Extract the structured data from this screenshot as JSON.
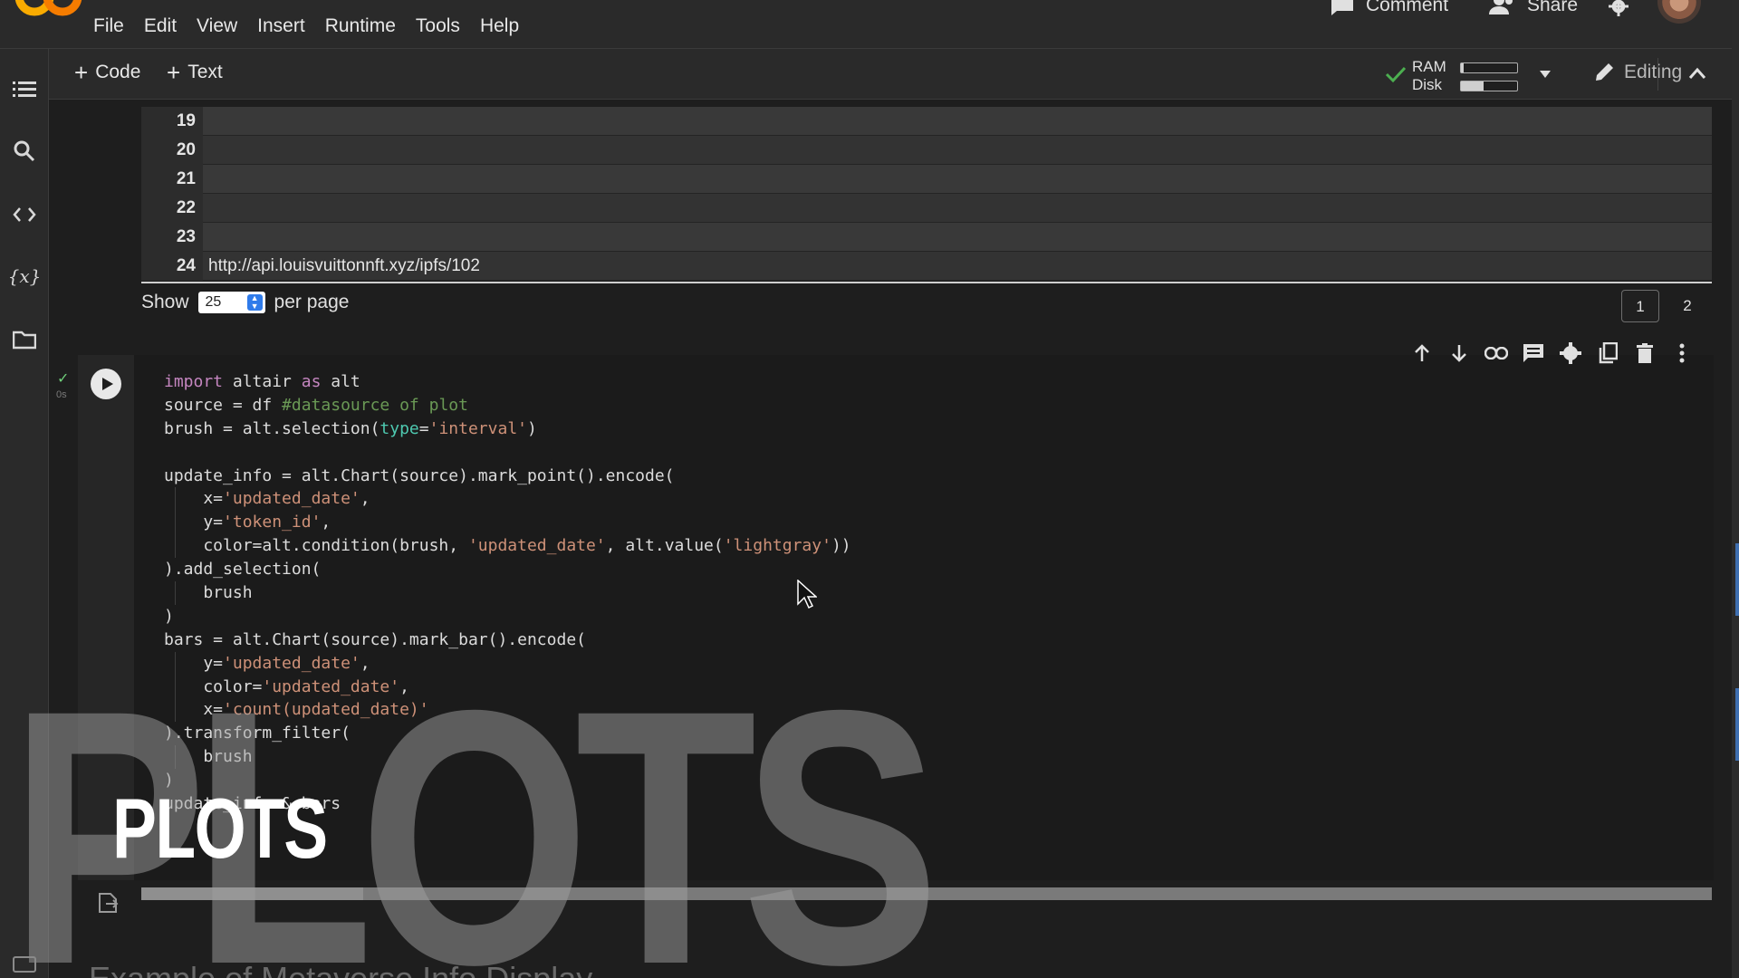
{
  "menu": [
    "File",
    "Edit",
    "View",
    "Insert",
    "Runtime",
    "Tools",
    "Help"
  ],
  "top_right": {
    "comment": "Comment",
    "share": "Share"
  },
  "toolbar": {
    "add_code": "Code",
    "add_text": "Text",
    "ram_label": "RAM",
    "disk_label": "Disk",
    "ram_usage": 0.05,
    "disk_usage": 0.4,
    "editing": "Editing"
  },
  "table": {
    "rows": [
      {
        "index": "19",
        "value": ""
      },
      {
        "index": "20",
        "value": ""
      },
      {
        "index": "21",
        "value": ""
      },
      {
        "index": "22",
        "value": ""
      },
      {
        "index": "23",
        "value": ""
      },
      {
        "index": "24",
        "value": "http://api.louisvuittonnft.xyz/ipfs/102"
      }
    ],
    "show_label": "Show",
    "per_page_value": "25",
    "per_page_label": "per page",
    "pages": [
      "1",
      "2"
    ],
    "current_page": "1"
  },
  "cell": {
    "status_time": "0s",
    "code_lines": [
      [
        {
          "t": "import",
          "c": "kw"
        },
        {
          "t": " altair "
        },
        {
          "t": "as",
          "c": "kw"
        },
        {
          "t": " alt"
        }
      ],
      [
        {
          "t": "source = df "
        },
        {
          "t": "#datasource of plot",
          "c": "cm"
        }
      ],
      [
        {
          "t": "brush = alt.selection("
        },
        {
          "t": "type",
          "c": "pm"
        },
        {
          "t": "="
        },
        {
          "t": "'interval'",
          "c": "st"
        },
        {
          "t": ")"
        }
      ],
      [],
      [
        {
          "t": "update_info = alt.Chart(source).mark_point().encode("
        }
      ],
      [
        {
          "t": "    x="
        },
        {
          "t": "'updated_date'",
          "c": "st"
        },
        {
          "t": ","
        }
      ],
      [
        {
          "t": "    y="
        },
        {
          "t": "'token_id'",
          "c": "st"
        },
        {
          "t": ","
        }
      ],
      [
        {
          "t": "    color=alt.condition(brush, "
        },
        {
          "t": "'updated_date'",
          "c": "st"
        },
        {
          "t": ", alt.value("
        },
        {
          "t": "'lightgray'",
          "c": "st"
        },
        {
          "t": "))"
        }
      ],
      [
        {
          "t": ").add_selection("
        }
      ],
      [
        {
          "t": "    brush"
        }
      ],
      [
        {
          "t": ")"
        }
      ],
      [
        {
          "t": "bars = alt.Chart(source).mark_bar().encode("
        }
      ],
      [
        {
          "t": "    y="
        },
        {
          "t": "'updated_date'",
          "c": "st"
        },
        {
          "t": ","
        }
      ],
      [
        {
          "t": "    color="
        },
        {
          "t": "'updated_date'",
          "c": "st"
        },
        {
          "t": ","
        }
      ],
      [
        {
          "t": "    x="
        },
        {
          "t": "'count(updated_date)'",
          "c": "st"
        }
      ],
      [
        {
          "t": ").transform_filter("
        }
      ],
      [
        {
          "t": "    brush"
        }
      ],
      [
        {
          "t": ")"
        }
      ],
      [
        {
          "t": "update_info & bars"
        }
      ]
    ]
  },
  "overlay": {
    "big_word": "PLOTS",
    "small_word": "PLOTS",
    "bottom_heading": "Example of Metaverse Info Display"
  }
}
